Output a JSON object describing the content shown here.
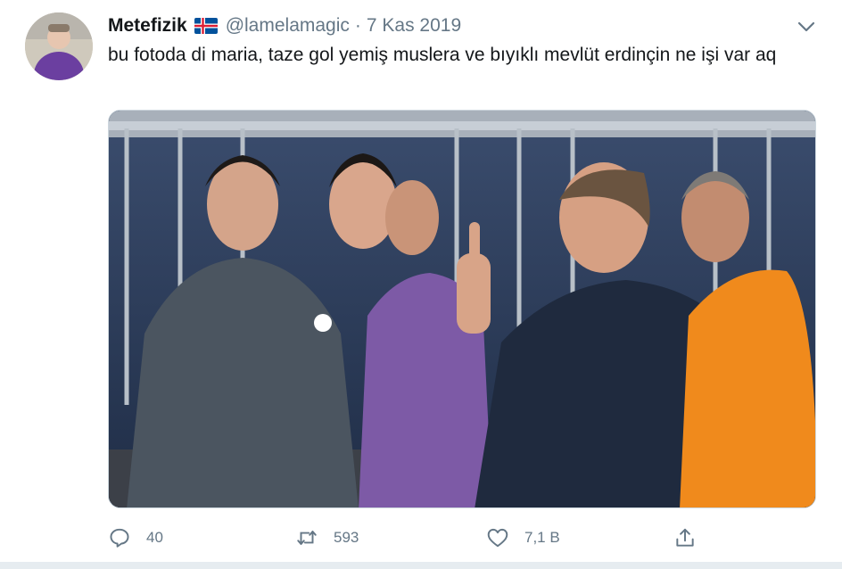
{
  "tweet": {
    "author": {
      "display_name": "Metefizik",
      "flag_icon": "iceland-flag-icon",
      "handle": "@lamelamagic",
      "separator": "·",
      "date": "7 Kas 2019"
    },
    "text": "bu fotoda di maria, taze gol yemiş muslera ve bıyıklı mevlüt erdinçin ne işi var aq",
    "actions": {
      "reply_count": "40",
      "retweet_count": "593",
      "like_count": "7,1 B"
    },
    "icons": [
      "caret-down-icon",
      "reply-icon",
      "retweet-icon",
      "like-icon",
      "share-icon"
    ],
    "colors": {
      "text": "#14171a",
      "secondary": "#657786",
      "border": "#ccd6dd"
    }
  }
}
